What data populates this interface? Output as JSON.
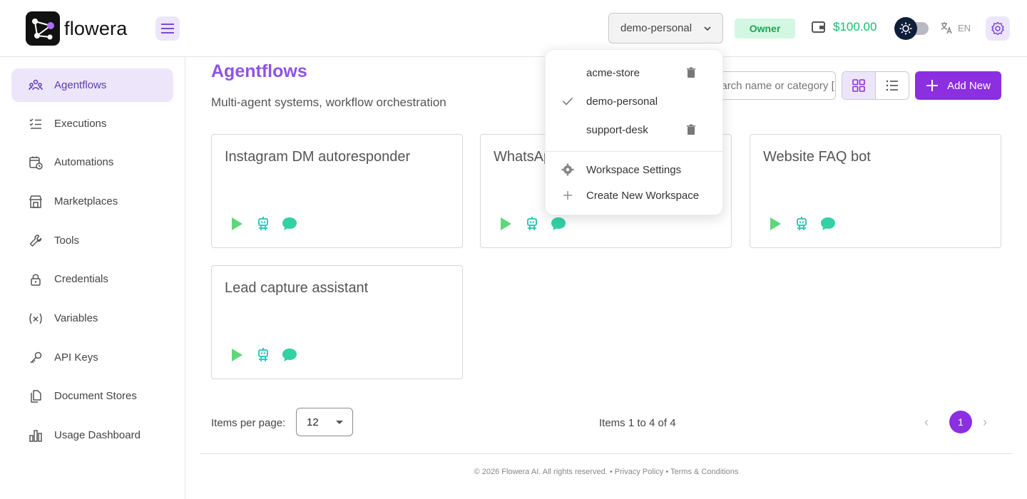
{
  "app": {
    "name": "flowera"
  },
  "header": {
    "workspace_selected": "demo-personal",
    "role_badge": "Owner",
    "wallet_balance": "$100.00",
    "language": "EN",
    "colors": {
      "accent": "#8b2fe0",
      "badge_bg": "#d3f7e3",
      "badge_text": "#1ea455",
      "balance": "#13c06b"
    }
  },
  "sidebar": {
    "items": [
      {
        "label": "Agentflows",
        "icon": "users-icon",
        "active": true
      },
      {
        "label": "Executions",
        "icon": "list-check-icon"
      },
      {
        "label": "Automations",
        "icon": "calendar-clock-icon"
      },
      {
        "label": "Marketplaces",
        "icon": "store-icon"
      },
      {
        "label": "Tools",
        "icon": "wrench-icon"
      },
      {
        "label": "Credentials",
        "icon": "lock-icon"
      },
      {
        "label": "Variables",
        "icon": "variable-icon"
      },
      {
        "label": "API Keys",
        "icon": "key-icon"
      },
      {
        "label": "Document Stores",
        "icon": "files-icon"
      },
      {
        "label": "Usage Dashboard",
        "icon": "bar-chart-icon"
      }
    ]
  },
  "main": {
    "title": "Agentflows",
    "subtitle": "Multi-agent systems, workflow orchestration",
    "search_placeholder": "Search name or category [ ⌘ + F ]",
    "add_button": "Add New",
    "cards": [
      {
        "title": "Instagram DM autoresponder"
      },
      {
        "title": "WhatsApp support agent"
      },
      {
        "title": "Website FAQ bot"
      },
      {
        "title": "Lead capture assistant"
      }
    ],
    "pagination": {
      "items_per_page_label": "Items per page:",
      "items_per_page": "12",
      "items_summary": "Items 1 to 4 of 4",
      "current_page": "1"
    },
    "footer": "© 2026 Flowera AI. All rights reserved. • Privacy Policy • Terms & Conditions"
  },
  "workspace_dropdown": {
    "workspaces": [
      {
        "name": "acme-store",
        "selected": false,
        "deletable": true
      },
      {
        "name": "demo-personal",
        "selected": true,
        "deletable": false
      },
      {
        "name": "support-desk",
        "selected": false,
        "deletable": true
      }
    ],
    "actions": [
      {
        "label": "Workspace Settings",
        "icon": "gear-icon"
      },
      {
        "label": "Create New Workspace",
        "icon": "plus-icon"
      }
    ]
  }
}
